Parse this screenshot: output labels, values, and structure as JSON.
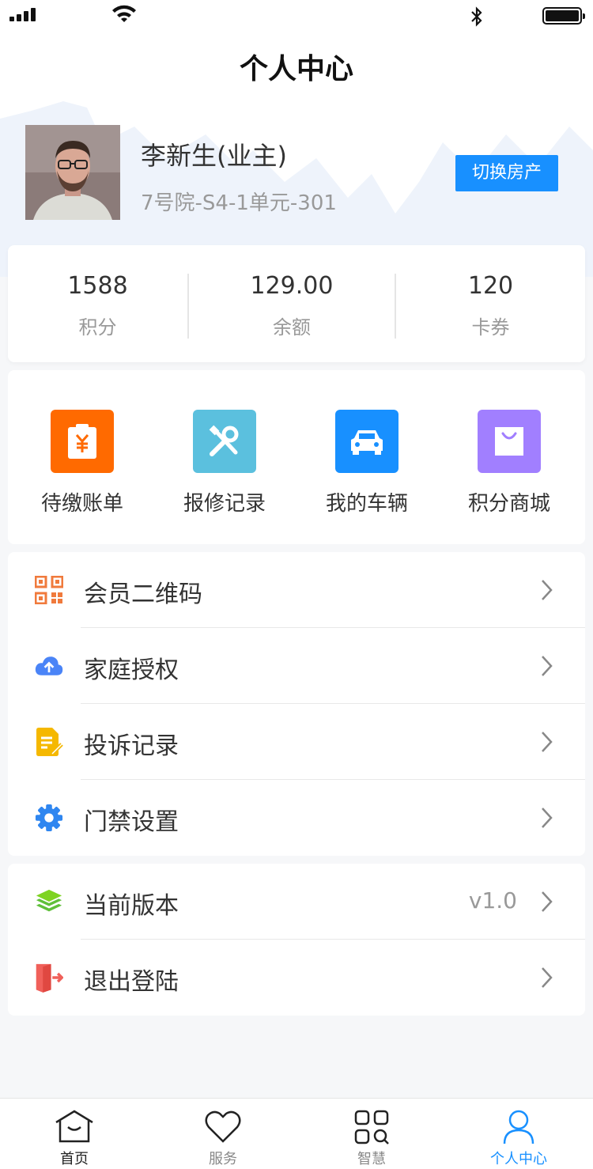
{
  "header": {
    "title": "个人中心"
  },
  "profile": {
    "name": "李新生(业主)",
    "address": "7号院-S4-1单元-301",
    "switch_label": "切换房产"
  },
  "stats": [
    {
      "value": "1588",
      "label": "积分"
    },
    {
      "value": "129.00",
      "label": "余额"
    },
    {
      "value": "120",
      "label": "卡券"
    }
  ],
  "quick_actions": [
    {
      "label": "待缴账单",
      "icon": "bill-icon",
      "color": "#ff6a00"
    },
    {
      "label": "报修记录",
      "icon": "repair-tools-icon",
      "color": "#5bc0de"
    },
    {
      "label": "我的车辆",
      "icon": "car-icon",
      "color": "#1890ff"
    },
    {
      "label": "积分商城",
      "icon": "shopping-bag-icon",
      "color": "#a17fff"
    }
  ],
  "menu_group1": [
    {
      "label": "会员二维码",
      "icon": "qr-code-icon"
    },
    {
      "label": "家庭授权",
      "icon": "cloud-upload-icon"
    },
    {
      "label": "投诉记录",
      "icon": "document-edit-icon"
    },
    {
      "label": "门禁设置",
      "icon": "gear-icon"
    }
  ],
  "menu_group2": [
    {
      "label": "当前版本",
      "icon": "layers-icon",
      "value": "v1.0"
    },
    {
      "label": "退出登陆",
      "icon": "logout-door-icon"
    }
  ],
  "tabbar": {
    "items": [
      {
        "label": "首页",
        "icon": "home-icon"
      },
      {
        "label": "服务",
        "icon": "heart-icon"
      },
      {
        "label": "智慧",
        "icon": "grid-search-icon"
      },
      {
        "label": "个人中心",
        "icon": "person-icon"
      }
    ],
    "active_index": 3
  },
  "colors": {
    "accent": "#1890ff",
    "bill": "#ff6a00",
    "repair": "#5bc0de",
    "mall": "#a17fff",
    "logout": "#f0605a",
    "version": "#7ed321"
  }
}
